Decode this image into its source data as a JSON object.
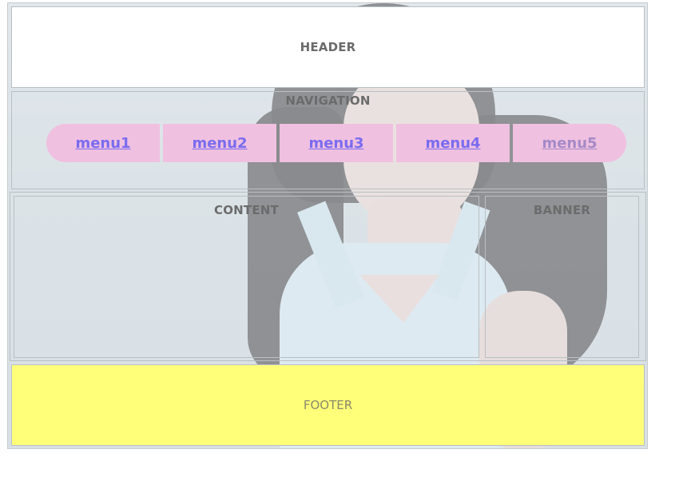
{
  "header": {
    "label": "HEADER"
  },
  "navigation": {
    "label": "NAVIGATION",
    "menu": [
      {
        "label": "menu1"
      },
      {
        "label": "menu2"
      },
      {
        "label": "menu3"
      },
      {
        "label": "menu4"
      },
      {
        "label": "menu5"
      }
    ]
  },
  "content": {
    "label": "CONTENT"
  },
  "banner": {
    "label": "BANNER"
  },
  "footer": {
    "label": "FOOTER"
  },
  "colors": {
    "menu_background": "#f0c0e0",
    "link": "#7a6cf0",
    "visited_link": "#a58ac8",
    "footer_background": "#ffff7a"
  }
}
